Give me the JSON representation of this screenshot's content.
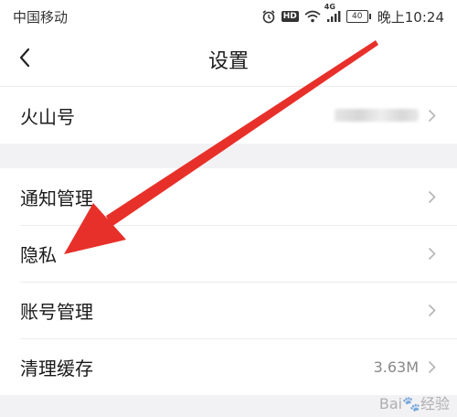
{
  "status_bar": {
    "carrier": "中国移动",
    "network_badge": "4G",
    "hd_badge": "HD",
    "battery": "40",
    "time": "晚上10:24",
    "icons": [
      "alarm-icon",
      "hd-icon",
      "wifi-icon",
      "signal-icon",
      "battery-icon"
    ]
  },
  "header": {
    "back_icon": "chevron-left-icon",
    "title": "设置"
  },
  "groups": [
    {
      "items": [
        {
          "label": "火山号",
          "value": "",
          "value_blurred": true
        }
      ]
    },
    {
      "items": [
        {
          "label": "通知管理",
          "value": ""
        },
        {
          "label": "隐私",
          "value": ""
        },
        {
          "label": "账号管理",
          "value": ""
        },
        {
          "label": "清理缓存",
          "value": "3.63M"
        }
      ]
    }
  ],
  "annotation": {
    "color": "#e8302a",
    "points_to": "隐私"
  },
  "colors": {
    "background": "#f2f2f4",
    "card": "#ffffff",
    "divider": "#ececec",
    "chevron": "#b5b5b5"
  }
}
